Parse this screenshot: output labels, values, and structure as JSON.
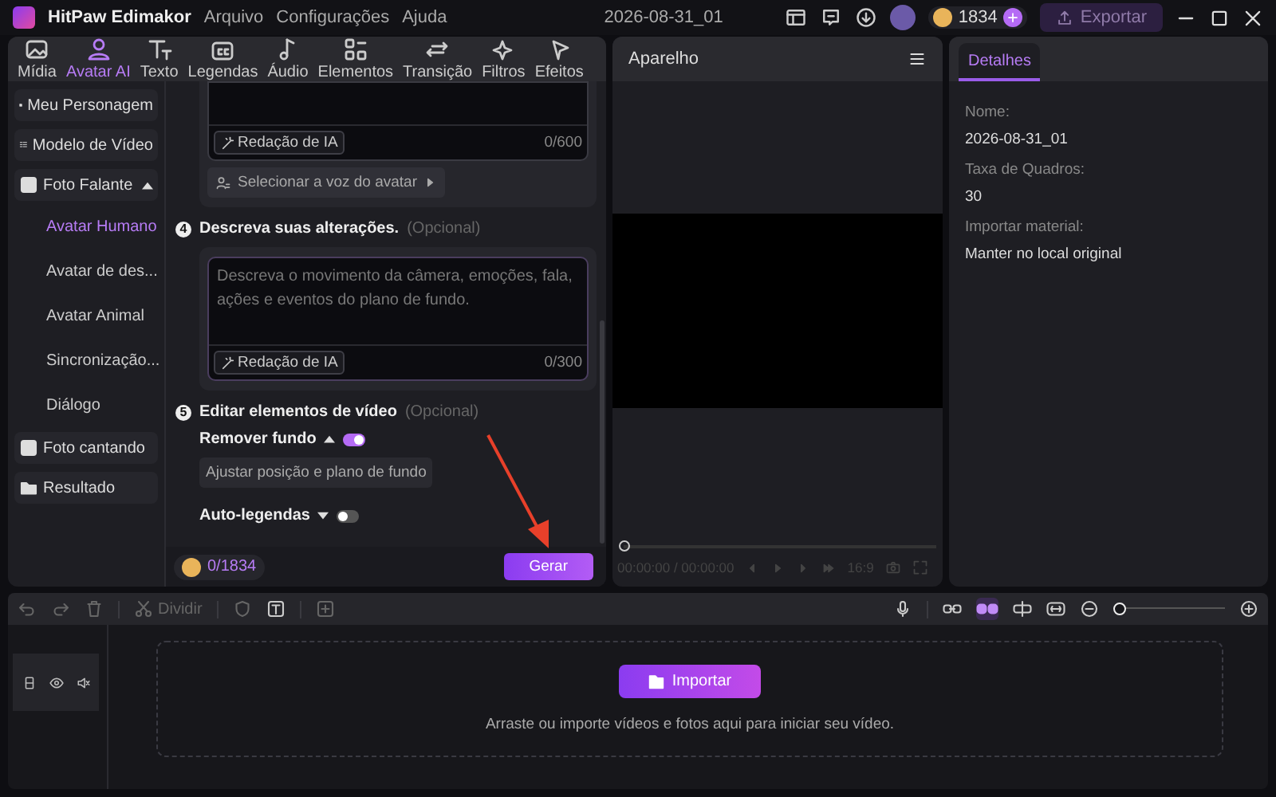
{
  "app": {
    "name": "HitPaw Edimakor",
    "menu": [
      "Arquivo",
      "Configurações",
      "Ajuda"
    ],
    "project_title": "2026-08-31_01",
    "coins": "1834",
    "export_button": "Exportar"
  },
  "tabs": [
    {
      "label": "Mídia",
      "selected": false
    },
    {
      "label": "Avatar AI",
      "selected": true
    },
    {
      "label": "Texto",
      "selected": false
    },
    {
      "label": "Legendas",
      "selected": false
    },
    {
      "label": "Áudio",
      "selected": false
    },
    {
      "label": "Elementos",
      "selected": false
    },
    {
      "label": "Transição",
      "selected": false
    },
    {
      "label": "Filtros",
      "selected": false
    },
    {
      "label": "Efeitos",
      "selected": false
    }
  ],
  "sidebar": {
    "items": [
      {
        "label": "Meu Personagem",
        "selected": false
      },
      {
        "label": "Modelo de Vídeo",
        "selected": false
      },
      {
        "label": "Foto Falante",
        "selected": false,
        "expanded": true,
        "children": [
          {
            "label": "Avatar Humano",
            "selected": true
          },
          {
            "label": "Avatar de des...",
            "selected": false
          },
          {
            "label": "Avatar Animal",
            "selected": false
          },
          {
            "label": "Sincronização...",
            "selected": false
          },
          {
            "label": "Diálogo",
            "selected": false
          }
        ]
      },
      {
        "label": "Foto cantando",
        "selected": false
      },
      {
        "label": "Resultado",
        "selected": false
      }
    ]
  },
  "script_box": {
    "ai_button": "Redação de IA",
    "counter": "0/600",
    "voice_button": "Selecionar a voz do avatar"
  },
  "step_4": {
    "number": "4",
    "title": "Descreva suas alterações.",
    "hint": "(Opcional)",
    "field": {
      "placeholder": "Descreva o movimento da câmera, emoções, fala, ações e eventos do plano de fundo.",
      "ai_button": "Redação de IA",
      "counter": "0/300"
    }
  },
  "step_5": {
    "number": "5",
    "title": "Editar elementos de vídeo",
    "hint": "(Opcional)",
    "options": [
      {
        "label": "Remover fundo",
        "expanded": true,
        "on": true,
        "action": "Ajustar posição e plano de fundo"
      },
      {
        "label": "Auto-legendas",
        "expanded": false,
        "on": false
      }
    ]
  },
  "footer": {
    "credits": "0/1834",
    "generate_button": "Gerar"
  },
  "preview": {
    "title": "Aparelho",
    "level": 0,
    "time": "00:00:00 / 00:00:00",
    "aspect": "16:9"
  },
  "details": {
    "tabs": [
      {
        "label": "Detalhes",
        "selected": true
      }
    ],
    "fields": [
      {
        "label": "Nome:",
        "value": "2026-08-31_01"
      },
      {
        "label": "Taxa de Quadros:",
        "value": "30"
      },
      {
        "label": "Importar material:",
        "value": "Manter no local original"
      }
    ]
  },
  "timeline": {
    "split_button": "Dividir",
    "zoom": {
      "level": 0
    },
    "import_button": "Importar",
    "hint": "Arraste ou importe vídeos e fotos aqui para iniciar seu vídeo."
  }
}
